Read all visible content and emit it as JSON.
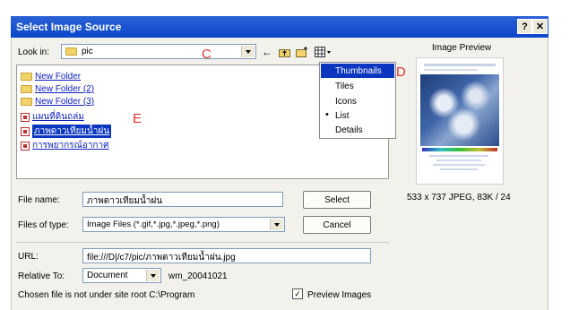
{
  "dialog": {
    "title": "Select Image Source",
    "help_btn": "?",
    "close_btn": "✕"
  },
  "lookin": {
    "label": "Look in:",
    "value": "pic"
  },
  "view_menu": {
    "items": [
      "Thumbnails",
      "Tiles",
      "Icons",
      "List",
      "Details"
    ],
    "selected": "Thumbnails",
    "checked": "List"
  },
  "files": [
    {
      "name": "New Folder",
      "type": "folder"
    },
    {
      "name": "New Folder (2)",
      "type": "folder"
    },
    {
      "name": "New Folder (3)",
      "type": "folder"
    },
    {
      "name": "แผนที่ดินถล่ม",
      "type": "image"
    },
    {
      "name": "ภาพดาวเทียมน้ำฝน",
      "type": "image",
      "selected": true
    },
    {
      "name": "การพยากรณ์อากาศ",
      "type": "image"
    }
  ],
  "form": {
    "file_name_label": "File name:",
    "file_name_value": "ภาพดาวเทียมน้ำฝน",
    "files_of_type_label": "Files of type:",
    "files_of_type_value": "Image Files (*.gif,*.jpg,*.jpeg,*.png)",
    "select_btn": "Select",
    "cancel_btn": "Cancel",
    "url_label": "URL:",
    "url_value": "file:///D|/c7/pic/ภาพดาวเทียมน้ำฝน.jpg",
    "relative_label": "Relative To:",
    "relative_value": "Document",
    "relative_file": "wm_20041021",
    "warning": "Chosen file is not under site root C:\\Program",
    "preview_label": "Preview Images",
    "preview_checked": true
  },
  "preview": {
    "title": "Image Preview",
    "info": "533 x 737 JPEG, 83K / 24"
  },
  "annotations": {
    "c": "C",
    "d": "D",
    "e": "E"
  },
  "colors": {
    "title_bar": "#0a46c9",
    "selection": "#0a36c0",
    "link": "#1020c0",
    "annotation": "#e03030"
  }
}
